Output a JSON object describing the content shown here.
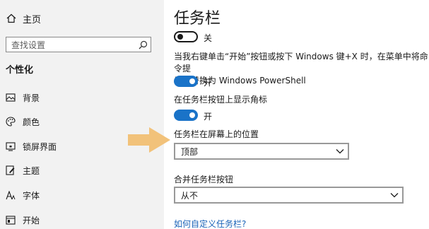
{
  "sidebar": {
    "home_label": "主页",
    "search_placeholder": "查找设置",
    "section_title": "个性化",
    "items": [
      {
        "label": "背景",
        "icon": "picture-icon"
      },
      {
        "label": "颜色",
        "icon": "palette-icon"
      },
      {
        "label": "锁屏界面",
        "icon": "lock-screen-icon"
      },
      {
        "label": "主题",
        "icon": "brush-icon"
      },
      {
        "label": "字体",
        "icon": "font-icon"
      },
      {
        "label": "开始",
        "icon": "start-icon"
      }
    ]
  },
  "main": {
    "title": "任务栏",
    "toggle1": {
      "state_label": "关",
      "on": false
    },
    "setting2": {
      "label_line1": "当我右键单击“开始”按钮或按下 Windows 键+X 时，在菜单中将命令提",
      "label_line2": "示符替换为 Windows PowerShell",
      "state_label": "开",
      "on": true
    },
    "setting3": {
      "label": "在任务栏按钮上显示角标",
      "state_label": "开",
      "on": true
    },
    "position": {
      "label": "任务栏在屏幕上的位置",
      "value": "顶部"
    },
    "combine": {
      "label": "合并任务栏按钮",
      "value": "从不"
    },
    "link": "如何自定义任务栏?"
  },
  "colors": {
    "accent": "#1a73c8",
    "arrow": "#f2c27a",
    "sidebar_bg": "#f2f2f2",
    "link": "#1a63b8"
  }
}
